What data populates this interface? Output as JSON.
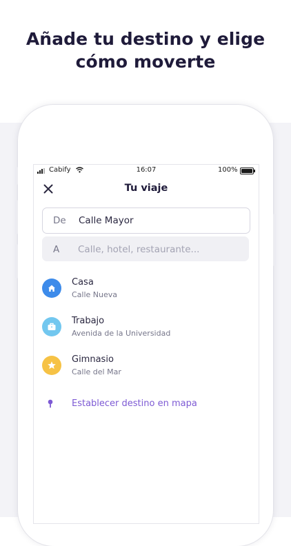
{
  "headline": {
    "line1": "Añade tu destino y elige",
    "line2": "cómo moverte"
  },
  "status_bar": {
    "carrier": "Cabify",
    "time": "16:07",
    "battery": "100%"
  },
  "nav": {
    "title": "Tu viaje",
    "close_icon": "close-icon"
  },
  "route": {
    "from": {
      "prefix": "De",
      "value": "Calle Mayor"
    },
    "to": {
      "prefix": "A",
      "placeholder": "Calle, hotel, restaurante...",
      "value": ""
    }
  },
  "saved_places": [
    {
      "name": "Casa",
      "address": "Calle Nueva",
      "icon": "home-icon",
      "color": "#3d8bea"
    },
    {
      "name": "Trabajo",
      "address": "Avenida de la Universidad",
      "icon": "briefcase-icon",
      "color": "#72c7ef"
    },
    {
      "name": "Gimnasio",
      "address": "Calle del Mar",
      "icon": "star-icon",
      "color": "#f6c245"
    }
  ],
  "map_option": {
    "label": "Establecer destino en mapa",
    "icon": "map-pin-icon",
    "color": "#7d5ad4"
  }
}
